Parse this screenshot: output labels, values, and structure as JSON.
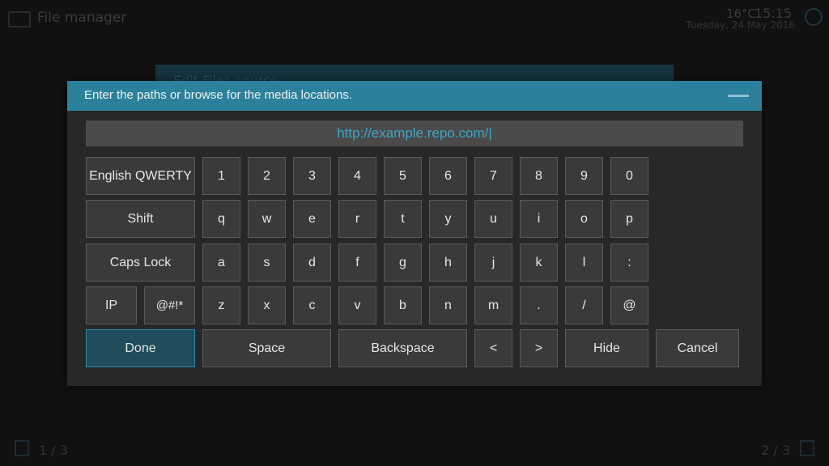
{
  "background": {
    "title": "File manager",
    "weather": "16°C",
    "time": "15:15",
    "date": "Tuesday, 24 May 2016",
    "dialog_title": "Edit Files source",
    "page_left": "1 / 3",
    "page_right": "2 / 3"
  },
  "dialog": {
    "heading": "Enter the paths or browse for the media locations.",
    "input_value": "http://example.repo.com/",
    "cursor": "|"
  },
  "keyboard": {
    "layout_label": "English QWERTY",
    "shift": "Shift",
    "caps_lock": "Caps Lock",
    "ip": "IP",
    "symbols": "@#!*",
    "done": "Done",
    "space": "Space",
    "backspace": "Backspace",
    "left": "<",
    "right": ">",
    "hide": "Hide",
    "cancel": "Cancel",
    "row1": [
      "1",
      "2",
      "3",
      "4",
      "5",
      "6",
      "7",
      "8",
      "9",
      "0"
    ],
    "row2": [
      "q",
      "w",
      "e",
      "r",
      "t",
      "y",
      "u",
      "i",
      "o",
      "p"
    ],
    "row3": [
      "a",
      "s",
      "d",
      "f",
      "g",
      "h",
      "j",
      "k",
      "l",
      ":"
    ],
    "row4": [
      "z",
      "x",
      "c",
      "v",
      "b",
      "n",
      "m",
      ".",
      "/",
      "@"
    ]
  },
  "colors": {
    "header": "#2b819b",
    "accent_text": "#3aa6c7",
    "done_key": "#1f4d5b"
  }
}
